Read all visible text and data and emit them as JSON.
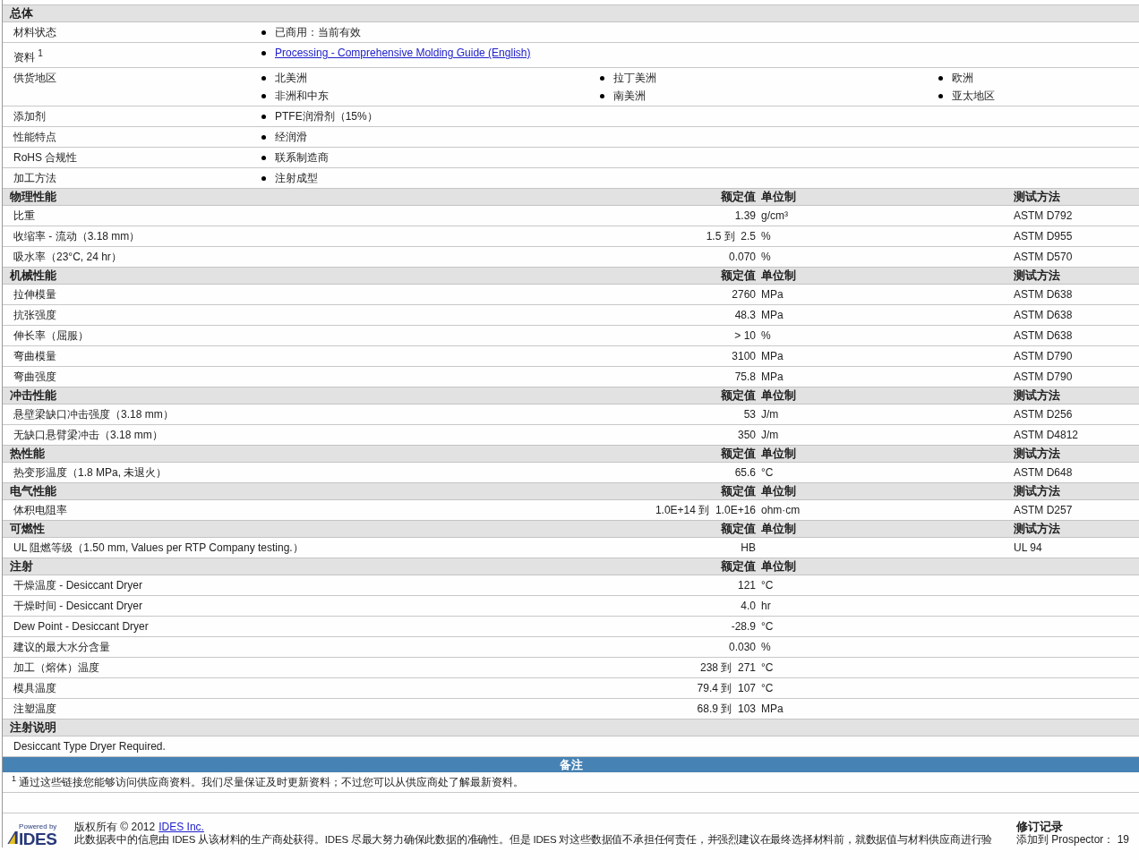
{
  "general": {
    "title": "总体",
    "rows": [
      {
        "label": "材料状态",
        "items": [
          {
            "kind": "text",
            "text": "已商用：当前有效"
          }
        ]
      },
      {
        "label": "资料 $^{1}$",
        "items": [
          {
            "kind": "link",
            "text": "Processing - Comprehensive Molding Guide (English)"
          }
        ]
      },
      {
        "label": "供货地区",
        "items": [
          {
            "kind": "text",
            "text": "北美洲"
          },
          {
            "kind": "text",
            "text": "拉丁美洲"
          },
          {
            "kind": "text",
            "text": "欧洲"
          },
          {
            "kind": "text",
            "text": "非洲和中东"
          },
          {
            "kind": "text",
            "text": "南美洲"
          },
          {
            "kind": "text",
            "text": "亚太地区"
          }
        ]
      },
      {
        "label": "添加剂",
        "items": [
          {
            "kind": "text",
            "text": "PTFE润滑剂（15%）"
          }
        ]
      },
      {
        "label": "性能特点",
        "items": [
          {
            "kind": "text",
            "text": "经润滑"
          }
        ]
      },
      {
        "label": "RoHS 合规性",
        "items": [
          {
            "kind": "text",
            "text": "联系制造商"
          }
        ]
      },
      {
        "label": "加工方法",
        "items": [
          {
            "kind": "text",
            "text": "注射成型"
          }
        ]
      }
    ]
  },
  "sections": [
    {
      "title": "物理性能",
      "value_header": "额定值",
      "unit_header": "单位制",
      "method_header": "测试方法",
      "rows": [
        {
          "label": "比重",
          "value": "1.39",
          "unit": "g/cm³",
          "method": "ASTM D792"
        },
        {
          "label": "收缩率 - 流动（3.18 mm）",
          "value": "1.5 到  2.5",
          "unit": "%",
          "method": "ASTM D955"
        },
        {
          "label": "吸水率（23°C, 24 hr）",
          "value": "0.070",
          "unit": "%",
          "method": "ASTM D570"
        }
      ]
    },
    {
      "title": "机械性能",
      "value_header": "额定值",
      "unit_header": "单位制",
      "method_header": "测试方法",
      "rows": [
        {
          "label": "拉伸模量",
          "value": "2760",
          "unit": "MPa",
          "method": "ASTM D638"
        },
        {
          "label": "抗张强度",
          "value": "48.3",
          "unit": "MPa",
          "method": "ASTM D638"
        },
        {
          "label": "伸长率（屈服）",
          "value": "> 10",
          "unit": "%",
          "method": "ASTM D638"
        },
        {
          "label": "弯曲模量",
          "value": "3100",
          "unit": "MPa",
          "method": "ASTM D790"
        },
        {
          "label": "弯曲强度",
          "value": "75.8",
          "unit": "MPa",
          "method": "ASTM D790"
        }
      ]
    },
    {
      "title": "冲击性能",
      "value_header": "额定值",
      "unit_header": "单位制",
      "method_header": "测试方法",
      "rows": [
        {
          "label": "悬壁梁缺口冲击强度（3.18 mm）",
          "value": "53",
          "unit": "J/m",
          "method": "ASTM D256"
        },
        {
          "label": "无缺口悬臂梁冲击（3.18 mm）",
          "value": "350",
          "unit": "J/m",
          "method": "ASTM D4812"
        }
      ]
    },
    {
      "title": "热性能",
      "value_header": "额定值",
      "unit_header": "单位制",
      "method_header": "测试方法",
      "rows": [
        {
          "label": "热变形温度（1.8 MPa, 未退火）",
          "value": "65.6",
          "unit": "°C",
          "method": "ASTM D648"
        }
      ]
    },
    {
      "title": "电气性能",
      "value_header": "额定值",
      "unit_header": "单位制",
      "method_header": "测试方法",
      "rows": [
        {
          "label": "体积电阻率",
          "value": "1.0E+14 到  1.0E+16",
          "unit": "ohm·cm",
          "method": "ASTM D257"
        }
      ]
    },
    {
      "title": "可燃性",
      "value_header": "额定值",
      "unit_header": "单位制",
      "method_header": "测试方法",
      "rows": [
        {
          "label": "UL 阻燃等级（1.50 mm, Values per RTP Company testing.）",
          "value": "HB",
          "method": "UL 94"
        }
      ]
    },
    {
      "title": "注射",
      "value_header": "额定值",
      "unit_header": "单位制",
      "rows": [
        {
          "label": "干燥温度 - Desiccant Dryer",
          "value": "121",
          "unit": "°C"
        },
        {
          "label": "干燥时间 - Desiccant Dryer",
          "value": "4.0",
          "unit": "hr"
        },
        {
          "label": "Dew Point - Desiccant Dryer",
          "value": "-28.9",
          "unit": "°C"
        },
        {
          "label": "建议的最大水分含量",
          "value": "0.030",
          "unit": "%"
        },
        {
          "label": "加工（熔体）温度",
          "value": "238 到  271",
          "unit": "°C"
        },
        {
          "label": "模具温度",
          "value": "79.4 到  107",
          "unit": "°C"
        },
        {
          "label": "注塑温度",
          "value": "68.9 到  103",
          "unit": "MPa"
        }
      ]
    }
  ],
  "injection_notes": {
    "title": "注射说明",
    "text": "Desiccant Type Dryer Required."
  },
  "remarks": {
    "title": "备注",
    "footnote_mark": "1",
    "footnote": "通过这些链接您能够访问供应商资料。我们尽量保证及时更新资料；不过您可以从供应商处了解最新资料。"
  },
  "footer": {
    "logo_top": "Powered by",
    "logo_name": "IDES",
    "copyright": "版权所有 © 2012",
    "company_link": "IDES Inc.",
    "disclaimer": "此数据表中的信息由 IDES 从该材料的生产商处获得。IDES 尽最大努力确保此数据的准确性。但是 IDES 对这些数据值不承担任何责任，并强烈建议在最终选择材料前，就数据值与材料供应商进行验",
    "revision_title": "修订记录",
    "revision_line": "添加到 Prospector： 19"
  }
}
